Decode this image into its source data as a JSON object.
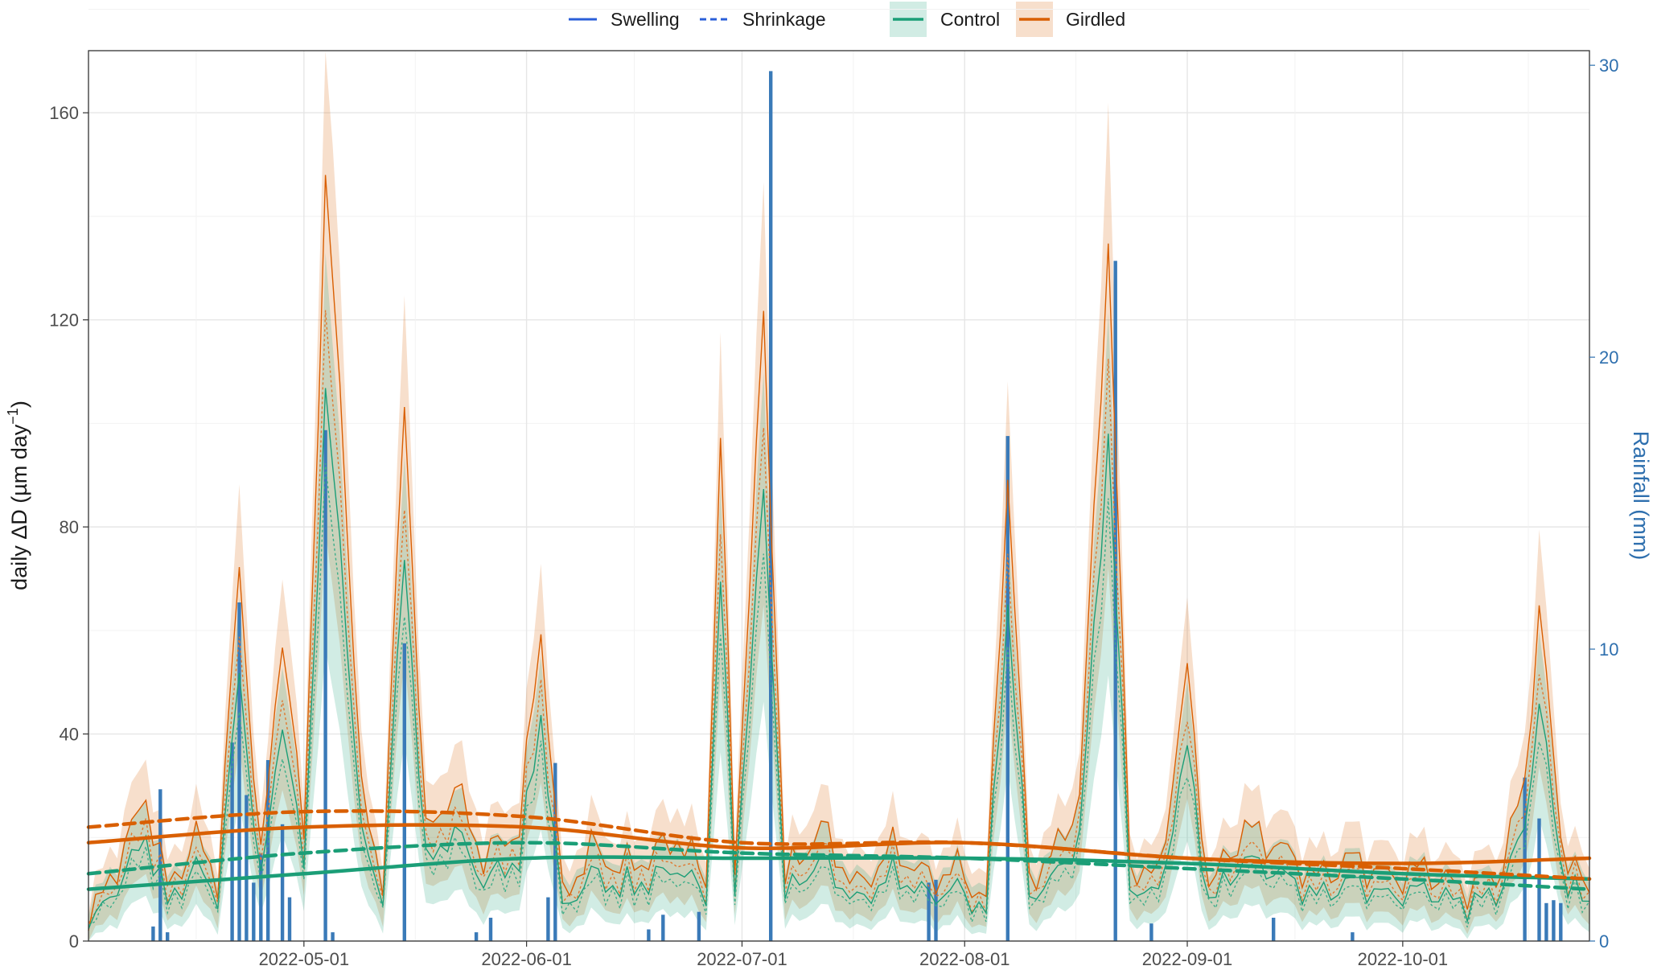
{
  "legend": {
    "swelling_label": "Swelling",
    "shrinkage_label": "Shrinkage",
    "control_label": "Control",
    "girdled_label": "Girdled"
  },
  "chart_data": {
    "type": "line",
    "title": "",
    "ylabel": "daily ΔD (µm day⁻¹)",
    "ylabel_main": "daily ΔD (µm day",
    "ylabel_sup": "−1",
    "ylabel_close": ")",
    "y2label": "Rainfall (mm)",
    "ylim": [
      0,
      172
    ],
    "y2lim": [
      0,
      30.5
    ],
    "xlim": [
      "2022-04-01",
      "2022-10-27"
    ],
    "x_ticks": [
      "2022-05-01",
      "2022-06-01",
      "2022-07-01",
      "2022-08-01",
      "2022-09-01",
      "2022-10-01"
    ],
    "y_ticks": [
      0,
      40,
      80,
      120,
      160
    ],
    "y2_ticks": [
      0,
      10,
      20,
      30
    ],
    "grid": true,
    "legend_position": "top",
    "colors": {
      "control": "#1b9e77",
      "girdled": "#d95f02",
      "rainfall": "#3a7ab8",
      "swelling": "#2b5fd9",
      "right_axis": "#2e6fae"
    },
    "daily_peaks": [
      [
        "2022-04-01",
        3
      ],
      [
        "2022-04-06",
        18
      ],
      [
        "2022-04-09",
        28
      ],
      [
        "2022-04-12",
        10
      ],
      [
        "2022-04-16",
        20
      ],
      [
        "2022-04-19",
        12
      ],
      [
        "2022-04-22",
        72
      ],
      [
        "2022-04-25",
        15
      ],
      [
        "2022-04-28",
        60
      ],
      [
        "2022-05-01",
        20
      ],
      [
        "2022-05-04",
        145
      ],
      [
        "2022-05-06",
        108
      ],
      [
        "2022-05-09",
        28
      ],
      [
        "2022-05-12",
        12
      ],
      [
        "2022-05-15",
        104
      ],
      [
        "2022-05-18",
        20
      ],
      [
        "2022-05-22",
        30
      ],
      [
        "2022-05-26",
        16
      ],
      [
        "2022-05-31",
        22
      ],
      [
        "2022-06-03",
        60
      ],
      [
        "2022-06-06",
        8
      ],
      [
        "2022-06-10",
        18
      ],
      [
        "2022-06-14",
        14
      ],
      [
        "2022-06-18",
        16
      ],
      [
        "2022-06-22",
        20
      ],
      [
        "2022-06-26",
        12
      ],
      [
        "2022-06-28",
        97
      ],
      [
        "2022-06-30",
        15
      ],
      [
        "2022-07-04",
        120
      ],
      [
        "2022-07-07",
        12
      ],
      [
        "2022-07-12",
        22
      ],
      [
        "2022-07-17",
        10
      ],
      [
        "2022-07-22",
        18
      ],
      [
        "2022-07-27",
        12
      ],
      [
        "2022-07-31",
        14
      ],
      [
        "2022-08-04",
        8
      ],
      [
        "2022-08-07",
        90
      ],
      [
        "2022-08-10",
        12
      ],
      [
        "2022-08-14",
        18
      ],
      [
        "2022-08-17",
        28
      ],
      [
        "2022-08-21",
        135
      ],
      [
        "2022-08-24",
        15
      ],
      [
        "2022-08-28",
        12
      ],
      [
        "2022-09-01",
        52
      ],
      [
        "2022-09-04",
        10
      ],
      [
        "2022-09-09",
        22
      ],
      [
        "2022-09-14",
        18
      ],
      [
        "2022-09-19",
        12
      ],
      [
        "2022-09-24",
        16
      ],
      [
        "2022-09-29",
        12
      ],
      [
        "2022-10-04",
        14
      ],
      [
        "2022-10-09",
        10
      ],
      [
        "2022-10-14",
        12
      ],
      [
        "2022-10-18",
        30
      ],
      [
        "2022-10-20",
        65
      ],
      [
        "2022-10-23",
        20
      ],
      [
        "2022-10-27",
        8
      ]
    ],
    "series": [
      {
        "name": "Control",
        "style": "solid",
        "x": [
          "2022-04-01",
          "2022-05-01",
          "2022-06-01",
          "2022-07-01",
          "2022-08-01",
          "2022-09-01",
          "2022-10-01",
          "2022-10-27"
        ],
        "values": [
          10,
          13,
          16,
          16,
          16,
          15,
          13,
          12
        ]
      },
      {
        "name": "Control",
        "style": "dashed",
        "x": [
          "2022-04-01",
          "2022-05-01",
          "2022-06-01",
          "2022-07-01",
          "2022-08-01",
          "2022-09-01",
          "2022-10-01",
          "2022-10-27"
        ],
        "values": [
          13,
          17,
          19,
          17,
          16,
          14,
          12,
          10
        ]
      },
      {
        "name": "Girdled",
        "style": "solid",
        "x": [
          "2022-04-01",
          "2022-05-01",
          "2022-06-01",
          "2022-07-01",
          "2022-08-01",
          "2022-09-01",
          "2022-10-01",
          "2022-10-27"
        ],
        "values": [
          19,
          22,
          22,
          18,
          19,
          16,
          15,
          16
        ]
      },
      {
        "name": "Girdled",
        "style": "dashed",
        "x": [
          "2022-04-01",
          "2022-05-01",
          "2022-06-01",
          "2022-07-01",
          "2022-08-01",
          "2022-09-01",
          "2022-10-01",
          "2022-10-27"
        ],
        "values": [
          22,
          25,
          24,
          19,
          19,
          16,
          14,
          12
        ]
      }
    ],
    "rainfall": [
      [
        "2022-04-10",
        0.5
      ],
      [
        "2022-04-11",
        5.2
      ],
      [
        "2022-04-12",
        0.3
      ],
      [
        "2022-04-21",
        6.8
      ],
      [
        "2022-04-22",
        11.6
      ],
      [
        "2022-04-23",
        5.0
      ],
      [
        "2022-04-24",
        2.0
      ],
      [
        "2022-04-25",
        3.0
      ],
      [
        "2022-04-26",
        6.2
      ],
      [
        "2022-04-28",
        4.0
      ],
      [
        "2022-04-29",
        1.5
      ],
      [
        "2022-05-04",
        17.5
      ],
      [
        "2022-05-05",
        0.3
      ],
      [
        "2022-05-15",
        10.2
      ],
      [
        "2022-05-25",
        0.3
      ],
      [
        "2022-05-27",
        0.8
      ],
      [
        "2022-06-04",
        1.5
      ],
      [
        "2022-06-05",
        6.1
      ],
      [
        "2022-06-18",
        0.4
      ],
      [
        "2022-06-20",
        0.9
      ],
      [
        "2022-06-25",
        1.0
      ],
      [
        "2022-07-05",
        29.8
      ],
      [
        "2022-07-27",
        2.0
      ],
      [
        "2022-07-28",
        2.1
      ],
      [
        "2022-08-07",
        17.3
      ],
      [
        "2022-08-22",
        23.3
      ],
      [
        "2022-08-27",
        0.6
      ],
      [
        "2022-09-13",
        0.8
      ],
      [
        "2022-09-24",
        0.3
      ],
      [
        "2022-10-18",
        5.6
      ],
      [
        "2022-10-20",
        4.2
      ],
      [
        "2022-10-21",
        1.3
      ],
      [
        "2022-10-22",
        1.4
      ],
      [
        "2022-10-23",
        1.3
      ]
    ]
  }
}
